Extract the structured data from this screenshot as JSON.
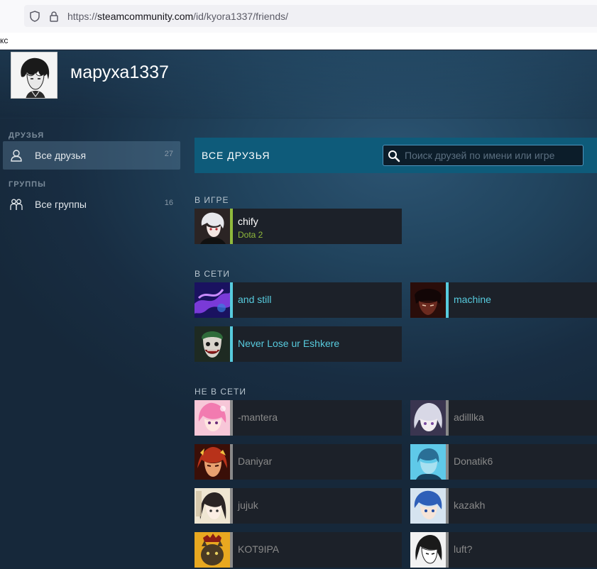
{
  "browser": {
    "url_prefix": "https://",
    "url_host": "steamcommunity.com",
    "url_path": "/id/kyora1337/friends/",
    "bookmark_fragment": "кс"
  },
  "profile": {
    "username": "маруха1337"
  },
  "sidebar": {
    "friends_heading": "ДРУЗЬЯ",
    "groups_heading": "ГРУППЫ",
    "items": [
      {
        "label": "Все друзья",
        "count": "27",
        "icon": "person-icon"
      },
      {
        "label": "Все группы",
        "count": "16",
        "icon": "group-icon"
      }
    ]
  },
  "main": {
    "title": "ВСЕ ДРУЗЬЯ",
    "search_placeholder": "Поиск друзей по имени или игре",
    "sections": {
      "ingame": "В ИГРЕ",
      "online": "В СЕТИ",
      "offline": "НЕ В СЕТИ"
    }
  },
  "friends": {
    "ingame": [
      {
        "name": "chify",
        "game": "Dota 2"
      }
    ],
    "online": [
      {
        "name": "and still"
      },
      {
        "name": "machine"
      },
      {
        "name": "Never Lose ur Eshkere"
      }
    ],
    "offline": [
      {
        "name": "-mantera"
      },
      {
        "name": "adilllka"
      },
      {
        "name": "Daniyar"
      },
      {
        "name": "Donatik6"
      },
      {
        "name": "jujuk"
      },
      {
        "name": "kazakh"
      },
      {
        "name": "KOT9IPA"
      },
      {
        "name": "luft?"
      }
    ]
  },
  "colors": {
    "ingame": "#90ba3c",
    "online": "#57cbde",
    "offline": "#898989",
    "title_bar": "#0e5b7a"
  }
}
